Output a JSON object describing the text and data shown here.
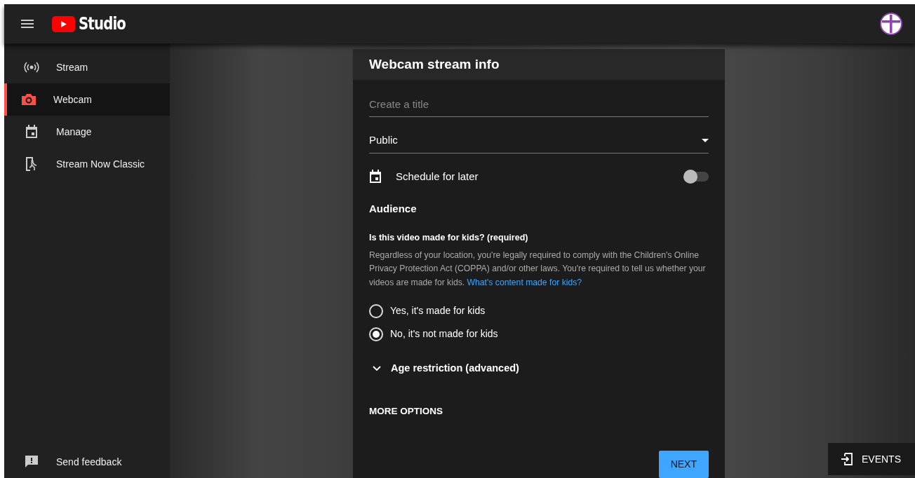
{
  "header": {
    "logo_text": "Studio"
  },
  "sidebar": {
    "items": [
      {
        "label": "Stream",
        "selected": false
      },
      {
        "label": "Webcam",
        "selected": true
      },
      {
        "label": "Manage",
        "selected": false
      },
      {
        "label": "Stream Now Classic",
        "selected": false
      }
    ],
    "footer_item": {
      "label": "Send feedback"
    }
  },
  "dialog": {
    "title": "Webcam stream info",
    "title_field": {
      "placeholder": "Create a title"
    },
    "visibility": {
      "value": "Public"
    },
    "schedule": {
      "label": "Schedule for later",
      "on": false
    },
    "audience": {
      "heading": "Audience",
      "question": "Is this video made for kids? (required)",
      "description": "Regardless of your location, you're legally required to comply with the Children's Online Privacy Protection Act (COPPA) and/or other laws. You're required to tell us whether your videos are made for kids.",
      "link": "What's content made for kids?",
      "options": [
        {
          "label": "Yes, it's made for kids",
          "selected": false
        },
        {
          "label": "No, it's not made for kids",
          "selected": true
        }
      ]
    },
    "age_restriction": {
      "label": "Age restriction (advanced)",
      "expanded": false
    },
    "more_options": "MORE OPTIONS",
    "next_button": "NEXT"
  },
  "events_button": "EVENTS"
}
